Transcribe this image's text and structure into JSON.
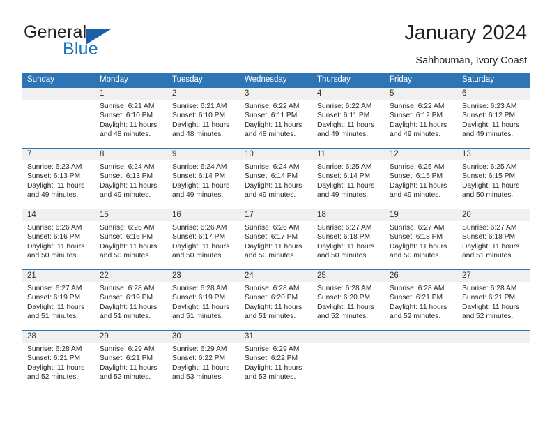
{
  "brand": {
    "name_part1": "General",
    "name_part2": "Blue",
    "accent_color": "#1b75bb",
    "triangle_icon": "triangle-icon"
  },
  "header": {
    "title": "January 2024",
    "subtitle": "Sahhouman, Ivory Coast"
  },
  "calendar": {
    "header_color": "#2e75b6",
    "weekdays": [
      "Sunday",
      "Monday",
      "Tuesday",
      "Wednesday",
      "Thursday",
      "Friday",
      "Saturday"
    ],
    "weeks": [
      [
        {
          "day": "",
          "sunrise": "",
          "sunset": "",
          "daylight_line1": "",
          "daylight_line2": ""
        },
        {
          "day": "1",
          "sunrise": "Sunrise: 6:21 AM",
          "sunset": "Sunset: 6:10 PM",
          "daylight_line1": "Daylight: 11 hours",
          "daylight_line2": "and 48 minutes."
        },
        {
          "day": "2",
          "sunrise": "Sunrise: 6:21 AM",
          "sunset": "Sunset: 6:10 PM",
          "daylight_line1": "Daylight: 11 hours",
          "daylight_line2": "and 48 minutes."
        },
        {
          "day": "3",
          "sunrise": "Sunrise: 6:22 AM",
          "sunset": "Sunset: 6:11 PM",
          "daylight_line1": "Daylight: 11 hours",
          "daylight_line2": "and 48 minutes."
        },
        {
          "day": "4",
          "sunrise": "Sunrise: 6:22 AM",
          "sunset": "Sunset: 6:11 PM",
          "daylight_line1": "Daylight: 11 hours",
          "daylight_line2": "and 49 minutes."
        },
        {
          "day": "5",
          "sunrise": "Sunrise: 6:22 AM",
          "sunset": "Sunset: 6:12 PM",
          "daylight_line1": "Daylight: 11 hours",
          "daylight_line2": "and 49 minutes."
        },
        {
          "day": "6",
          "sunrise": "Sunrise: 6:23 AM",
          "sunset": "Sunset: 6:12 PM",
          "daylight_line1": "Daylight: 11 hours",
          "daylight_line2": "and 49 minutes."
        }
      ],
      [
        {
          "day": "7",
          "sunrise": "Sunrise: 6:23 AM",
          "sunset": "Sunset: 6:13 PM",
          "daylight_line1": "Daylight: 11 hours",
          "daylight_line2": "and 49 minutes."
        },
        {
          "day": "8",
          "sunrise": "Sunrise: 6:24 AM",
          "sunset": "Sunset: 6:13 PM",
          "daylight_line1": "Daylight: 11 hours",
          "daylight_line2": "and 49 minutes."
        },
        {
          "day": "9",
          "sunrise": "Sunrise: 6:24 AM",
          "sunset": "Sunset: 6:14 PM",
          "daylight_line1": "Daylight: 11 hours",
          "daylight_line2": "and 49 minutes."
        },
        {
          "day": "10",
          "sunrise": "Sunrise: 6:24 AM",
          "sunset": "Sunset: 6:14 PM",
          "daylight_line1": "Daylight: 11 hours",
          "daylight_line2": "and 49 minutes."
        },
        {
          "day": "11",
          "sunrise": "Sunrise: 6:25 AM",
          "sunset": "Sunset: 6:14 PM",
          "daylight_line1": "Daylight: 11 hours",
          "daylight_line2": "and 49 minutes."
        },
        {
          "day": "12",
          "sunrise": "Sunrise: 6:25 AM",
          "sunset": "Sunset: 6:15 PM",
          "daylight_line1": "Daylight: 11 hours",
          "daylight_line2": "and 49 minutes."
        },
        {
          "day": "13",
          "sunrise": "Sunrise: 6:25 AM",
          "sunset": "Sunset: 6:15 PM",
          "daylight_line1": "Daylight: 11 hours",
          "daylight_line2": "and 50 minutes."
        }
      ],
      [
        {
          "day": "14",
          "sunrise": "Sunrise: 6:26 AM",
          "sunset": "Sunset: 6:16 PM",
          "daylight_line1": "Daylight: 11 hours",
          "daylight_line2": "and 50 minutes."
        },
        {
          "day": "15",
          "sunrise": "Sunrise: 6:26 AM",
          "sunset": "Sunset: 6:16 PM",
          "daylight_line1": "Daylight: 11 hours",
          "daylight_line2": "and 50 minutes."
        },
        {
          "day": "16",
          "sunrise": "Sunrise: 6:26 AM",
          "sunset": "Sunset: 6:17 PM",
          "daylight_line1": "Daylight: 11 hours",
          "daylight_line2": "and 50 minutes."
        },
        {
          "day": "17",
          "sunrise": "Sunrise: 6:26 AM",
          "sunset": "Sunset: 6:17 PM",
          "daylight_line1": "Daylight: 11 hours",
          "daylight_line2": "and 50 minutes."
        },
        {
          "day": "18",
          "sunrise": "Sunrise: 6:27 AM",
          "sunset": "Sunset: 6:18 PM",
          "daylight_line1": "Daylight: 11 hours",
          "daylight_line2": "and 50 minutes."
        },
        {
          "day": "19",
          "sunrise": "Sunrise: 6:27 AM",
          "sunset": "Sunset: 6:18 PM",
          "daylight_line1": "Daylight: 11 hours",
          "daylight_line2": "and 50 minutes."
        },
        {
          "day": "20",
          "sunrise": "Sunrise: 6:27 AM",
          "sunset": "Sunset: 6:18 PM",
          "daylight_line1": "Daylight: 11 hours",
          "daylight_line2": "and 51 minutes."
        }
      ],
      [
        {
          "day": "21",
          "sunrise": "Sunrise: 6:27 AM",
          "sunset": "Sunset: 6:19 PM",
          "daylight_line1": "Daylight: 11 hours",
          "daylight_line2": "and 51 minutes."
        },
        {
          "day": "22",
          "sunrise": "Sunrise: 6:28 AM",
          "sunset": "Sunset: 6:19 PM",
          "daylight_line1": "Daylight: 11 hours",
          "daylight_line2": "and 51 minutes."
        },
        {
          "day": "23",
          "sunrise": "Sunrise: 6:28 AM",
          "sunset": "Sunset: 6:19 PM",
          "daylight_line1": "Daylight: 11 hours",
          "daylight_line2": "and 51 minutes."
        },
        {
          "day": "24",
          "sunrise": "Sunrise: 6:28 AM",
          "sunset": "Sunset: 6:20 PM",
          "daylight_line1": "Daylight: 11 hours",
          "daylight_line2": "and 51 minutes."
        },
        {
          "day": "25",
          "sunrise": "Sunrise: 6:28 AM",
          "sunset": "Sunset: 6:20 PM",
          "daylight_line1": "Daylight: 11 hours",
          "daylight_line2": "and 52 minutes."
        },
        {
          "day": "26",
          "sunrise": "Sunrise: 6:28 AM",
          "sunset": "Sunset: 6:21 PM",
          "daylight_line1": "Daylight: 11 hours",
          "daylight_line2": "and 52 minutes."
        },
        {
          "day": "27",
          "sunrise": "Sunrise: 6:28 AM",
          "sunset": "Sunset: 6:21 PM",
          "daylight_line1": "Daylight: 11 hours",
          "daylight_line2": "and 52 minutes."
        }
      ],
      [
        {
          "day": "28",
          "sunrise": "Sunrise: 6:28 AM",
          "sunset": "Sunset: 6:21 PM",
          "daylight_line1": "Daylight: 11 hours",
          "daylight_line2": "and 52 minutes."
        },
        {
          "day": "29",
          "sunrise": "Sunrise: 6:29 AM",
          "sunset": "Sunset: 6:21 PM",
          "daylight_line1": "Daylight: 11 hours",
          "daylight_line2": "and 52 minutes."
        },
        {
          "day": "30",
          "sunrise": "Sunrise: 6:29 AM",
          "sunset": "Sunset: 6:22 PM",
          "daylight_line1": "Daylight: 11 hours",
          "daylight_line2": "and 53 minutes."
        },
        {
          "day": "31",
          "sunrise": "Sunrise: 6:29 AM",
          "sunset": "Sunset: 6:22 PM",
          "daylight_line1": "Daylight: 11 hours",
          "daylight_line2": "and 53 minutes."
        },
        {
          "day": "",
          "sunrise": "",
          "sunset": "",
          "daylight_line1": "",
          "daylight_line2": ""
        },
        {
          "day": "",
          "sunrise": "",
          "sunset": "",
          "daylight_line1": "",
          "daylight_line2": ""
        },
        {
          "day": "",
          "sunrise": "",
          "sunset": "",
          "daylight_line1": "",
          "daylight_line2": ""
        }
      ]
    ]
  }
}
